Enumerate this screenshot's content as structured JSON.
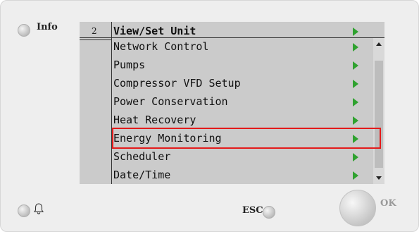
{
  "panel": {
    "info_label": "Info",
    "esc_label": "ESC",
    "ok_label": "OK"
  },
  "menu": {
    "level": "2",
    "title": "View/Set Unit",
    "items": [
      {
        "label": "Network Control"
      },
      {
        "label": "Pumps"
      },
      {
        "label": "Compressor VFD Setup"
      },
      {
        "label": "Power Conservation"
      },
      {
        "label": "Heat Recovery"
      },
      {
        "label": "Energy Monitoring",
        "highlighted": true
      },
      {
        "label": "Scheduler"
      },
      {
        "label": "Date/Time"
      }
    ]
  },
  "colors": {
    "arrow": "#2fa22f",
    "highlight": "#e31b1b",
    "screen": "#cbcbcb"
  },
  "icons": [
    "bell-icon",
    "arrow-right-icon",
    "scroll-up-icon",
    "scroll-down-icon"
  ]
}
